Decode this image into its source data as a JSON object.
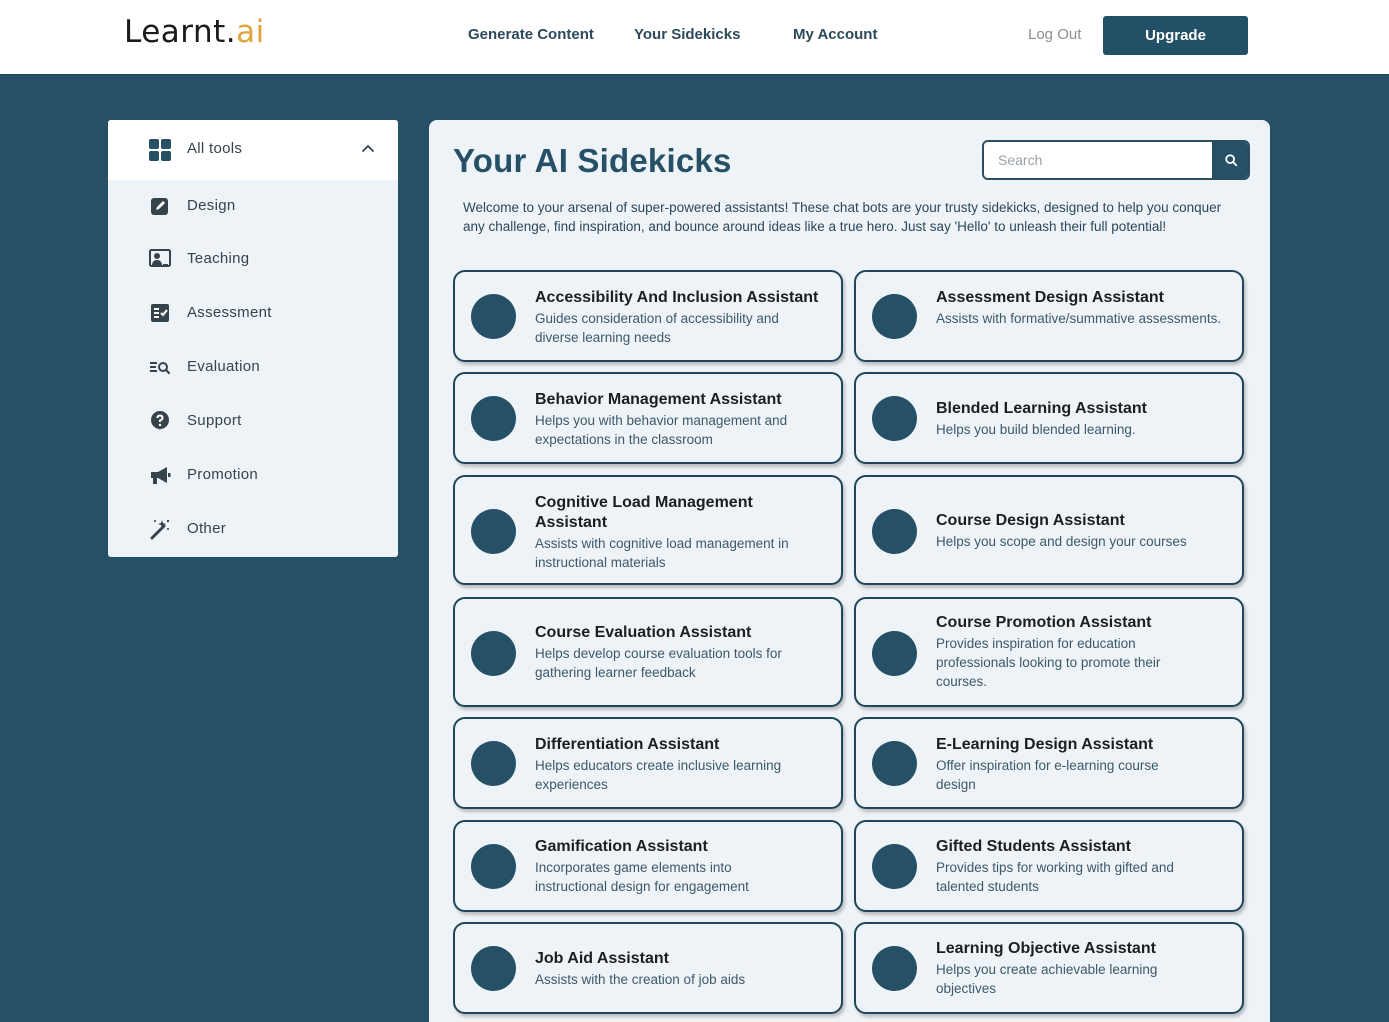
{
  "header": {
    "logo_main": "Learnt.",
    "logo_accent": "ai",
    "nav": [
      "Generate Content",
      "Your Sidekicks",
      "My Account"
    ],
    "logout": "Log Out",
    "upgrade": "Upgrade"
  },
  "sidebar": {
    "head_label": "All tools",
    "items": [
      {
        "label": "Design",
        "icon": "pencil-square-icon"
      },
      {
        "label": "Teaching",
        "icon": "teacher-board-icon"
      },
      {
        "label": "Assessment",
        "icon": "checklist-icon"
      },
      {
        "label": "Evaluation",
        "icon": "list-search-icon"
      },
      {
        "label": "Support",
        "icon": "question-circle-icon"
      },
      {
        "label": "Promotion",
        "icon": "megaphone-icon"
      },
      {
        "label": "Other",
        "icon": "magic-wand-icon"
      }
    ]
  },
  "main": {
    "title": "Your AI Sidekicks",
    "search_placeholder": "Search",
    "intro": "Welcome to your arsenal of super-powered assistants! These chat bots are your trusty sidekicks, designed to help you conquer any challenge, find inspiration, and bounce around ideas like a true hero. Just say 'Hello' to unleash their full potential!",
    "cards": [
      {
        "name": "Accessibility And Inclusion Assistant",
        "desc": "Guides consideration of accessibility and diverse learning needs"
      },
      {
        "name": "Assessment Design Assistant",
        "desc": "Assists with formative/summative assessments."
      },
      {
        "name": "Behavior Management Assistant",
        "desc": "Helps you with behavior management and expectations in the classroom"
      },
      {
        "name": "Blended Learning Assistant",
        "desc": "Helps you build blended learning."
      },
      {
        "name": "Cognitive Load Management Assistant",
        "desc": "Assists with cognitive load management in instructional materials"
      },
      {
        "name": "Course Design Assistant",
        "desc": "Helps you scope and design your courses"
      },
      {
        "name": "Course Evaluation Assistant",
        "desc": "Helps develop course evaluation tools for gathering learner feedback"
      },
      {
        "name": "Course Promotion Assistant",
        "desc": "Provides inspiration for education professionals looking to promote their courses."
      },
      {
        "name": "Differentiation Assistant",
        "desc": "Helps educators create inclusive learning experiences"
      },
      {
        "name": "E-Learning Design Assistant",
        "desc": "Offer inspiration for e-learning course design"
      },
      {
        "name": "Gamification Assistant",
        "desc": "Incorporates game elements into instructional design for engagement"
      },
      {
        "name": "Gifted Students Assistant",
        "desc": "Provides tips for working with gifted and talented students"
      },
      {
        "name": "Job Aid Assistant",
        "desc": "Assists with the creation of job aids"
      },
      {
        "name": "Learning Objective Assistant",
        "desc": "Helps you create achievable learning objectives"
      }
    ]
  },
  "colors": {
    "brand": "#265066",
    "logo_accent": "#e0a43a",
    "panel": "#eef3f7"
  }
}
